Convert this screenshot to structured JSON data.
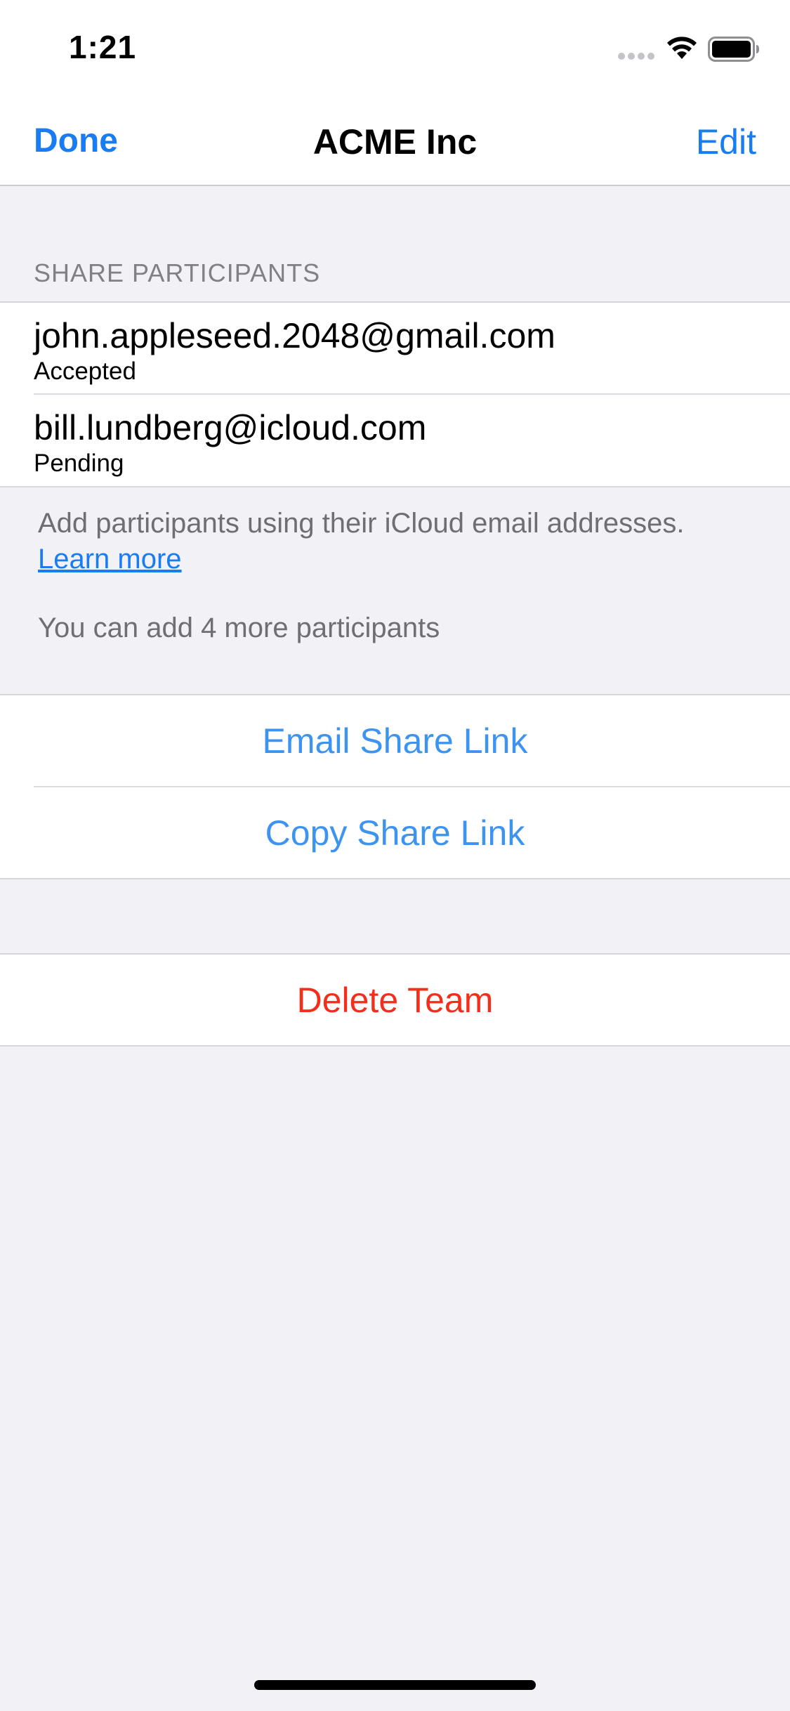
{
  "status_bar": {
    "time": "1:21",
    "icons": [
      "signal-icon",
      "wifi-icon",
      "battery-icon"
    ]
  },
  "nav": {
    "left_label": "Done",
    "title": "ACME Inc",
    "right_label": "Edit"
  },
  "participants_section": {
    "header": "SHARE PARTICIPANTS",
    "items": [
      {
        "email": "john.appleseed.2048@gmail.com",
        "status": "Accepted"
      },
      {
        "email": "bill.lundberg@icloud.com",
        "status": "Pending"
      }
    ],
    "footer": "Add participants using their iCloud email addresses.",
    "learn_more": "Learn more",
    "remaining": "You can add 4 more participants"
  },
  "share_actions": {
    "email_link": "Email Share Link",
    "copy_link": "Copy Share Link"
  },
  "danger_actions": {
    "delete": "Delete Team"
  },
  "colors": {
    "accent": "#1a7cf2",
    "action_blue": "#3d94f0",
    "destructive": "#f52e1c",
    "background": "#f1f1f6"
  }
}
